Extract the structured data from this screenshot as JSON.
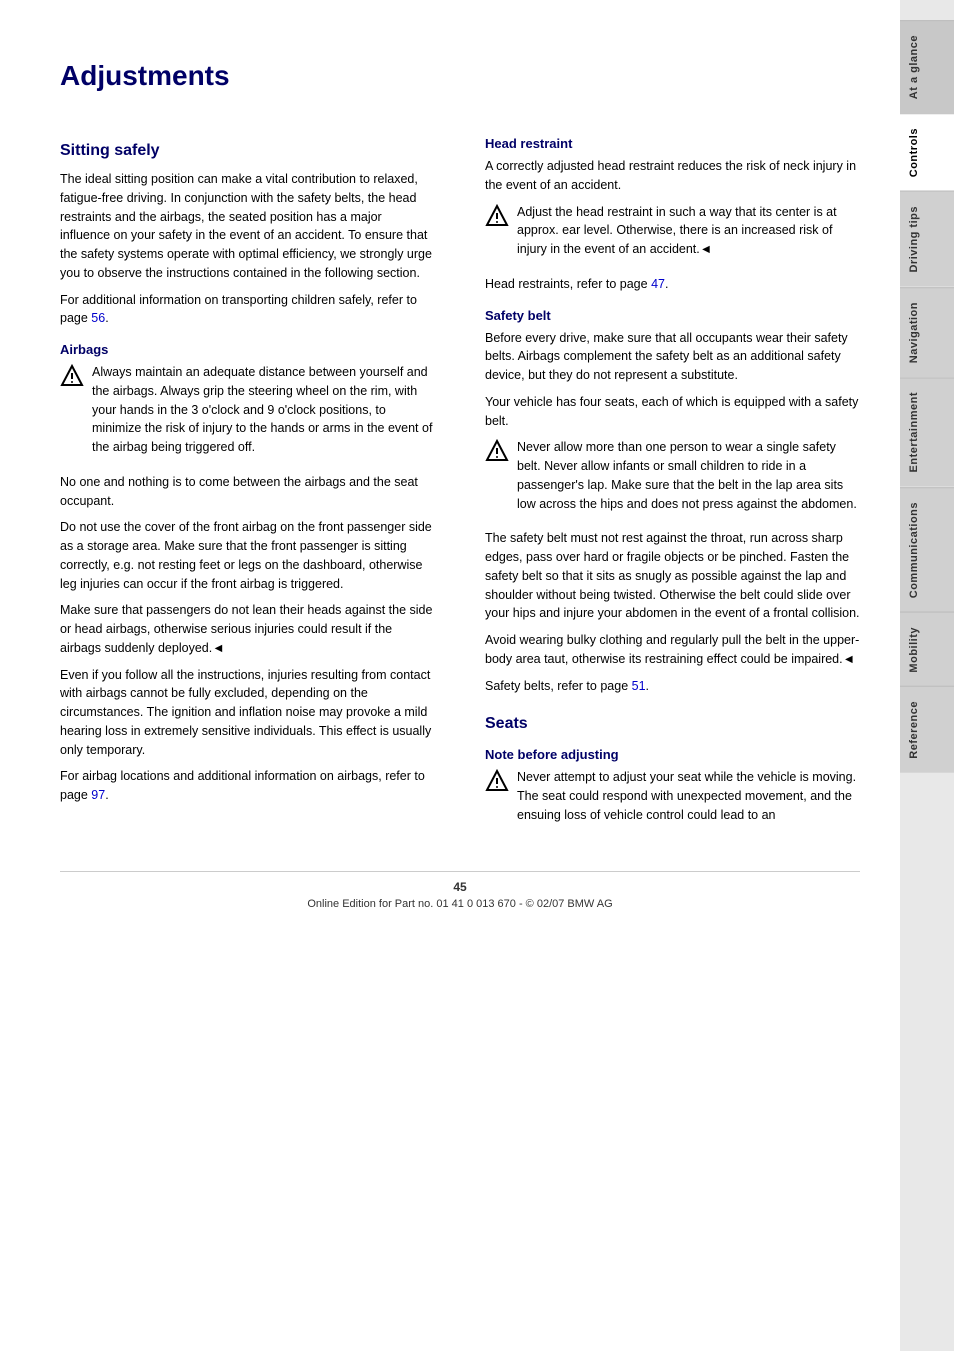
{
  "page": {
    "title": "Adjustments",
    "footer": "Online Edition for Part no. 01 41 0 013 670 - © 02/07 BMW AG",
    "page_number": "45"
  },
  "sidebar": {
    "tabs": [
      {
        "label": "At a glance",
        "active": false
      },
      {
        "label": "Controls",
        "active": true
      },
      {
        "label": "Driving tips",
        "active": false
      },
      {
        "label": "Navigation",
        "active": false
      },
      {
        "label": "Entertainment",
        "active": false
      },
      {
        "label": "Communications",
        "active": false
      },
      {
        "label": "Mobility",
        "active": false
      },
      {
        "label": "Reference",
        "active": false
      }
    ]
  },
  "sitting_safely": {
    "title": "Sitting safely",
    "intro": "The ideal sitting position can make a vital contribution to relaxed, fatigue-free driving. In conjunction with the safety belts, the head restraints and the airbags, the seated position has a major influence on your safety in the event of an accident. To ensure that the safety systems operate with optimal efficiency, we strongly urge you to observe the instructions contained in the following section.",
    "children_note": "For additional information on transporting children safely, refer to page",
    "children_page": "56",
    "airbags": {
      "title": "Airbags",
      "warning1_text": "Always maintain an adequate distance between yourself and the airbags. Always grip the steering wheel on the rim, with your hands in the 3 o'clock and 9 o'clock positions, to minimize the risk of injury to the hands or arms in the event of the airbag being triggered off.",
      "para1": "No one and nothing is to come between the airbags and the seat occupant.",
      "para2": "Do not use the cover of the front airbag on the front passenger side as a storage area. Make sure that the front passenger is sitting correctly, e.g. not resting feet or legs on the dashboard, otherwise leg injuries can occur if the front airbag is triggered.",
      "para3": "Make sure that passengers do not lean their heads against the side or head airbags, otherwise serious injuries could result if the airbags suddenly deployed.◄",
      "para4": "Even if you follow all the instructions, injuries resulting from contact with airbags cannot be fully excluded, depending on the circumstances. The ignition and inflation noise may provoke a mild hearing loss in extremely sensitive individuals. This effect is usually only temporary.",
      "airbag_ref": "For airbag locations and additional information on airbags, refer to page",
      "airbag_page": "97"
    }
  },
  "head_restraint": {
    "title": "Head restraint",
    "intro": "A correctly adjusted head restraint reduces the risk of neck injury in the event of an accident.",
    "warning_text": "Adjust the head restraint in such a way that its center is at approx. ear level. Otherwise, there is an increased risk of injury in the event of an accident.◄",
    "ref_text": "Head restraints, refer to page",
    "ref_page": "47"
  },
  "safety_belt": {
    "title": "Safety belt",
    "para1": "Before every drive, make sure that all occupants wear their safety belts. Airbags complement the safety belt as an additional safety device, but they do not represent a substitute.",
    "para2": "Your vehicle has four seats, each of which is equipped with a safety belt.",
    "warning_text": "Never allow more than one person to wear a single safety belt. Never allow infants or small children to ride in a passenger's lap. Make sure that the belt in the lap area sits low across the hips and does not press against the abdomen.",
    "para3": "The safety belt must not rest against the throat, run across sharp edges, pass over hard or fragile objects or be pinched. Fasten the safety belt so that it sits as snugly as possible against the lap and shoulder without being twisted. Otherwise the belt could slide over your hips and injure your abdomen in the event of a frontal collision.",
    "para4": "Avoid wearing bulky clothing and regularly pull the belt in the upper-body area taut, otherwise its restraining effect could be impaired.◄",
    "ref_text": "Safety belts, refer to page",
    "ref_page": "51"
  },
  "seats": {
    "title": "Seats",
    "note_title": "Note before adjusting",
    "warning_text": "Never attempt to adjust your seat while the vehicle is moving. The seat could respond with unexpected movement, and the ensuing loss of vehicle control could lead to an"
  }
}
